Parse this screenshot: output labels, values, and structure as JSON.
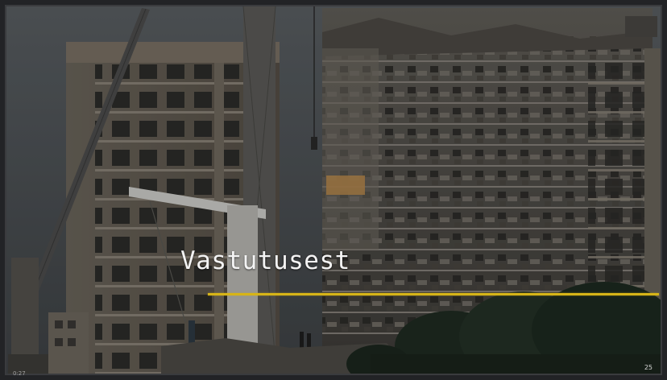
{
  "slide": {
    "title": "Vastutusest",
    "number": "25",
    "timestamp": "0:27"
  },
  "colors": {
    "accent_line": "#d6b418",
    "title_text": "#f3f3f3",
    "frame": "#222326"
  },
  "background_image": {
    "subject": "collapsed-building-with-cranes"
  }
}
